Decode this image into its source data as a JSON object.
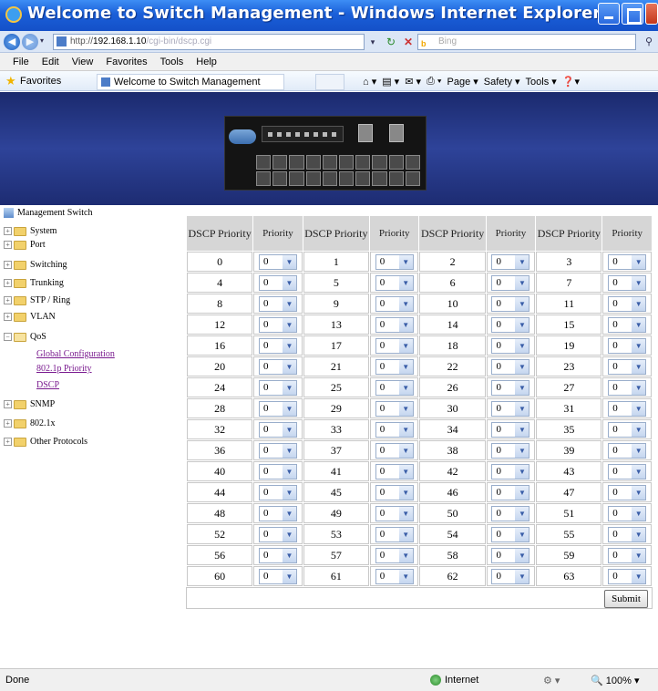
{
  "window": {
    "title": "Welcome to Switch Management - Windows Internet Explorer"
  },
  "address_bar": {
    "scheme": "http://",
    "host": "192.168.1.10",
    "path": "/cgi-bin/dscp.cgi",
    "search_placeholder": "Bing"
  },
  "menu": [
    "File",
    "Edit",
    "View",
    "Favorites",
    "Tools",
    "Help"
  ],
  "favorites": {
    "label": "Favorites",
    "tab_title": "Welcome to Switch Management",
    "commands": [
      "Page ▾",
      "Safety ▾",
      "Tools ▾"
    ]
  },
  "sidebar": {
    "root": "Management Switch",
    "items": [
      {
        "label": "System",
        "expanded": false
      },
      {
        "label": "Port",
        "expanded": false
      },
      {
        "label": "Switching",
        "expanded": false
      },
      {
        "label": "Trunking",
        "expanded": false
      },
      {
        "label": "STP / Ring",
        "expanded": false
      },
      {
        "label": "VLAN",
        "expanded": false
      },
      {
        "label": "QoS",
        "expanded": true
      },
      {
        "label": "SNMP",
        "expanded": false
      },
      {
        "label": "802.1x",
        "expanded": false
      },
      {
        "label": "Other Protocols",
        "expanded": false
      }
    ],
    "qos_children": [
      "Global Configuration",
      "802.1p Priority",
      "DSCP"
    ]
  },
  "table": {
    "header_dscp": "DSCP Priority",
    "header_priority": "Priority",
    "rows": [
      [
        0,
        1,
        2,
        3
      ],
      [
        4,
        5,
        6,
        7
      ],
      [
        8,
        9,
        10,
        11
      ],
      [
        12,
        13,
        14,
        15
      ],
      [
        16,
        17,
        18,
        19
      ],
      [
        20,
        21,
        22,
        23
      ],
      [
        24,
        25,
        26,
        27
      ],
      [
        28,
        29,
        30,
        31
      ],
      [
        32,
        33,
        34,
        35
      ],
      [
        36,
        37,
        38,
        39
      ],
      [
        40,
        41,
        42,
        43
      ],
      [
        44,
        45,
        46,
        47
      ],
      [
        48,
        49,
        50,
        51
      ],
      [
        52,
        53,
        54,
        55
      ],
      [
        56,
        57,
        58,
        59
      ],
      [
        60,
        61,
        62,
        63
      ]
    ],
    "priority_value": "0",
    "submit_label": "Submit"
  },
  "status": {
    "text": "Done",
    "zone": "Internet",
    "zoom": "100%"
  },
  "colors": {
    "titlebar": "#1a5fd8",
    "banner": "#2e4399",
    "header_cell": "#d6d6d6",
    "visited_link": "#7a1b8f"
  }
}
